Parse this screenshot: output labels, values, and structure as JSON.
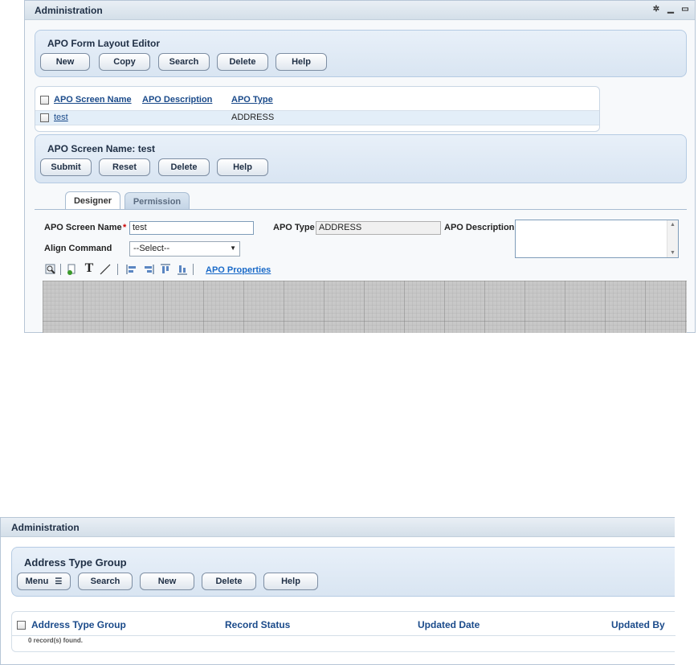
{
  "top_window": {
    "title": "Administration",
    "editor_panel": {
      "title": "APO Form Layout Editor",
      "buttons": [
        "New",
        "Copy",
        "Search",
        "Delete",
        "Help"
      ]
    },
    "list": {
      "headers": [
        "APO Screen Name",
        "APO Description",
        "APO Type"
      ],
      "rows": [
        {
          "screen_name": "test",
          "description": "",
          "type": "ADDRESS"
        }
      ]
    },
    "detail_panel": {
      "title": "APO Screen Name: test",
      "buttons": [
        "Submit",
        "Reset",
        "Delete",
        "Help"
      ]
    },
    "tabs": [
      {
        "label": "Designer",
        "active": true
      },
      {
        "label": "Permission",
        "active": false
      }
    ],
    "form": {
      "screen_name_label": "APO Screen Name",
      "required_marker": "*",
      "screen_name_value": "test",
      "type_label": "APO Type",
      "type_value": "ADDRESS",
      "description_label": "APO Description",
      "align_label": "Align Command",
      "align_value": "--Select--"
    },
    "toolbar": {
      "icons": [
        "zoom-icon",
        "add-field-icon",
        "text-icon",
        "line-icon",
        "align-left-icon",
        "align-right-icon",
        "align-top-icon",
        "align-bottom-icon"
      ],
      "properties_link": "APO Properties"
    }
  },
  "bottom_window": {
    "title": "Administration",
    "panel": {
      "title": "Address Type Group",
      "buttons": [
        "Menu",
        "Search",
        "New",
        "Delete",
        "Help"
      ]
    },
    "list": {
      "headers": [
        "Address Type Group",
        "Record Status",
        "Updated Date",
        "Updated By"
      ],
      "empty_text": "0 record(s) found."
    }
  },
  "colors": {
    "link_blue": "#1a4a8a",
    "panel_bg": "#dbe6f2",
    "required_red": "#cc0000"
  }
}
